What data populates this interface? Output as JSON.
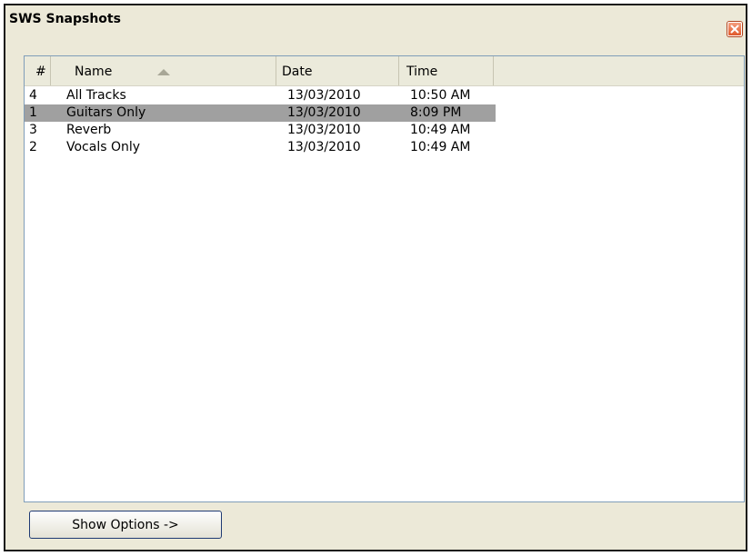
{
  "window": {
    "title": "SWS Snapshots"
  },
  "list": {
    "columns": [
      {
        "label": "#"
      },
      {
        "label": "Name",
        "sort": "ascending"
      },
      {
        "label": "Date"
      },
      {
        "label": "Time"
      }
    ],
    "rows": [
      {
        "num": "4",
        "name": "All Tracks",
        "date": "13/03/2010",
        "time": "10:50 AM",
        "selected": false
      },
      {
        "num": "1",
        "name": "Guitars Only",
        "date": "13/03/2010",
        "time": "8:09 PM",
        "selected": true
      },
      {
        "num": "3",
        "name": "Reverb",
        "date": "13/03/2010",
        "time": "10:49 AM",
        "selected": false
      },
      {
        "num": "2",
        "name": "Vocals Only",
        "date": "13/03/2010",
        "time": "10:49 AM",
        "selected": false
      }
    ]
  },
  "footer": {
    "show_options_label": "Show Options ->"
  },
  "colors": {
    "selection": "#a0a0a0",
    "close_button": "#e0582a",
    "window_background": "#ece9d8",
    "header_background": "#ebeadb"
  },
  "icons": {
    "close": "close-icon",
    "sort": "sort-ascending-icon"
  }
}
